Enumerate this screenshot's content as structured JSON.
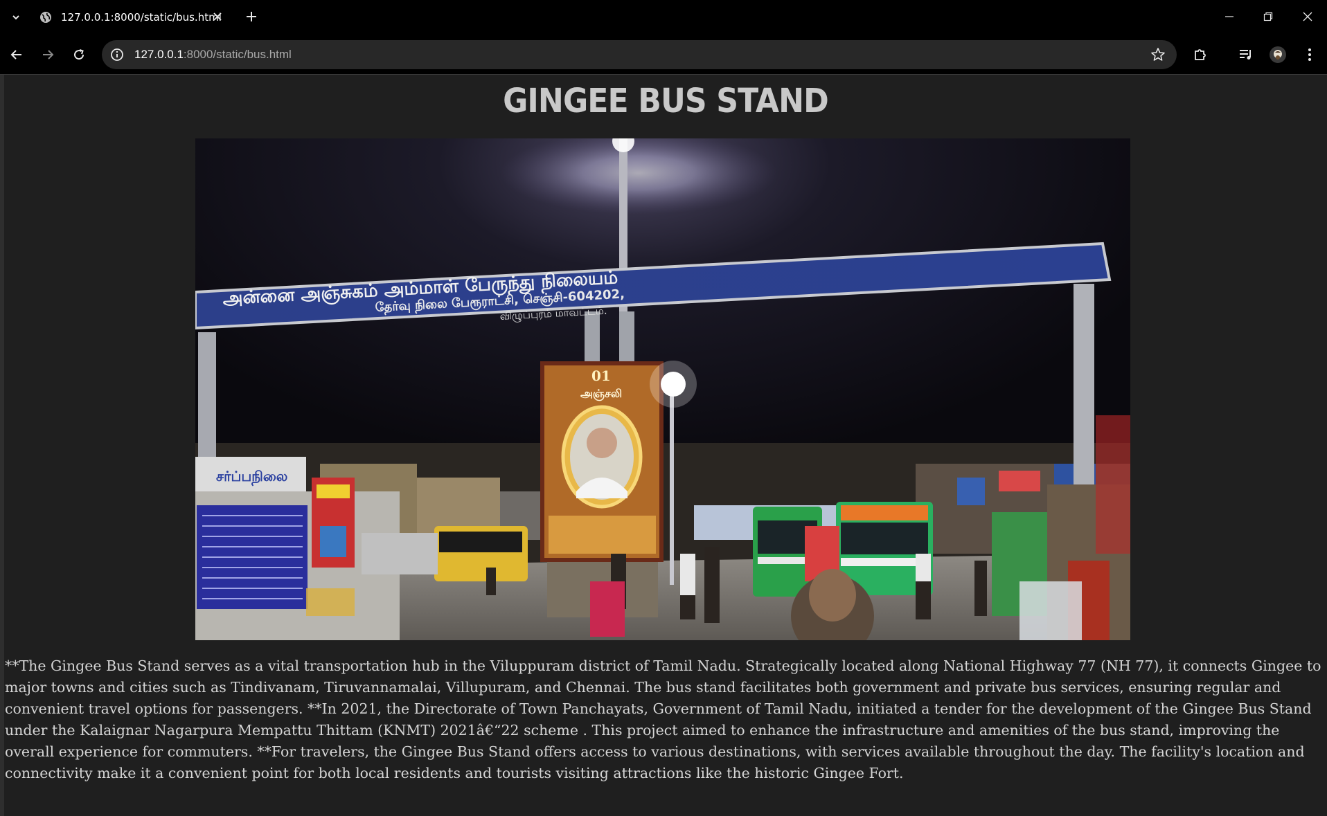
{
  "browser": {
    "tab_title": "127.0.0.1:8000/static/bus.html",
    "url_host": "127.0.0.1",
    "url_path": ":8000/static/bus.html"
  },
  "page": {
    "heading": "GINGEE BUS STAND",
    "photo": {
      "arch_text_line1": "அன்னை அஞ்சுகம் அம்மாள் பேருந்து நிலையம்",
      "arch_text_line2": "தேர்வு நிலை பேரூராட்சி, செஞ்சி-604202,",
      "arch_text_line3": "விழுப்புரம் மாவட்டம்.",
      "banner_number": "01",
      "banner_name": "அஞ்சலி"
    },
    "description": "**The Gingee Bus Stand serves as a vital transportation hub in the Viluppuram district of Tamil Nadu. Strategically located along National Highway 77 (NH 77), it connects Gingee to major towns and cities such as Tindivanam, Tiruvannamalai, Villupuram, and Chennai. The bus stand facilitates both government and private bus services, ensuring regular and convenient travel options for passengers. **In 2021, the Directorate of Town Panchayats, Government of Tamil Nadu, initiated a tender for the development of the Gingee Bus Stand under the Kalaignar Nagarpura Mempattu Thittam (KNMT) 2021â€“22 scheme . This project aimed to enhance the infrastructure and amenities of the bus stand, improving the overall experience for commuters. **For travelers, the Gingee Bus Stand offers access to various destinations, with services available throughout the day. The facility's location and connectivity make it a convenient point for both local residents and tourists visiting attractions like the historic Gingee Fort."
  },
  "icons": {
    "tab_dropdown": "chevron-down-icon",
    "favicon": "globe-icon",
    "tab_close": "close-icon",
    "new_tab": "plus-icon",
    "back": "arrow-left-icon",
    "forward": "arrow-right-icon",
    "reload": "reload-icon",
    "site_info": "info-icon",
    "bookmark": "star-icon",
    "extensions": "puzzle-icon",
    "media": "playlist-icon",
    "profile": "avatar",
    "menu": "kebab-menu-icon"
  }
}
